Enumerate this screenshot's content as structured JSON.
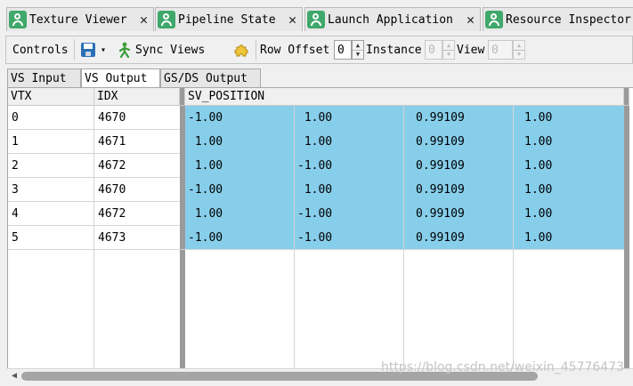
{
  "doc_tabs": [
    {
      "label": "Texture Viewer",
      "close": "✕"
    },
    {
      "label": "Pipeline State",
      "close": "✕"
    },
    {
      "label": "Launch Application",
      "close": "✕"
    },
    {
      "label": "Resource Inspector",
      "close": ""
    }
  ],
  "toolbar": {
    "controls_label": "Controls",
    "save_icon": "save-icon",
    "dropdown_arrow": "▾",
    "sync_label": "Sync Views",
    "puzzle_icon": "puzzle-icon",
    "row_offset_label": "Row Offset",
    "row_offset_value": "0",
    "instance_label": "Instance",
    "instance_value": "0",
    "view_label": "View",
    "view_value": "0"
  },
  "sub_tabs": [
    {
      "label": "VS Input",
      "active": false
    },
    {
      "label": "VS Output",
      "active": true
    },
    {
      "label": "GS/DS Output",
      "active": false
    }
  ],
  "grid": {
    "headers": [
      "VTX",
      "IDX",
      "SV_POSITION"
    ],
    "selection_color": "#87ceeb",
    "rows": [
      {
        "vtx": "0",
        "idx": "4670",
        "x": "-1.00",
        "y": " 1.00",
        "z": "0.99109",
        "w": "1.00"
      },
      {
        "vtx": "1",
        "idx": "4671",
        "x": " 1.00",
        "y": " 1.00",
        "z": "0.99109",
        "w": "1.00"
      },
      {
        "vtx": "2",
        "idx": "4672",
        "x": " 1.00",
        "y": "-1.00",
        "z": "0.99109",
        "w": "1.00"
      },
      {
        "vtx": "3",
        "idx": "4670",
        "x": "-1.00",
        "y": " 1.00",
        "z": "0.99109",
        "w": "1.00"
      },
      {
        "vtx": "4",
        "idx": "4672",
        "x": " 1.00",
        "y": "-1.00",
        "z": "0.99109",
        "w": "1.00"
      },
      {
        "vtx": "5",
        "idx": "4673",
        "x": "-1.00",
        "y": "-1.00",
        "z": "0.99109",
        "w": "1.00"
      }
    ]
  },
  "scrollbar": {
    "left_arrow": "◀"
  },
  "watermark": "https://blog.csdn.net/weixin_45776473"
}
